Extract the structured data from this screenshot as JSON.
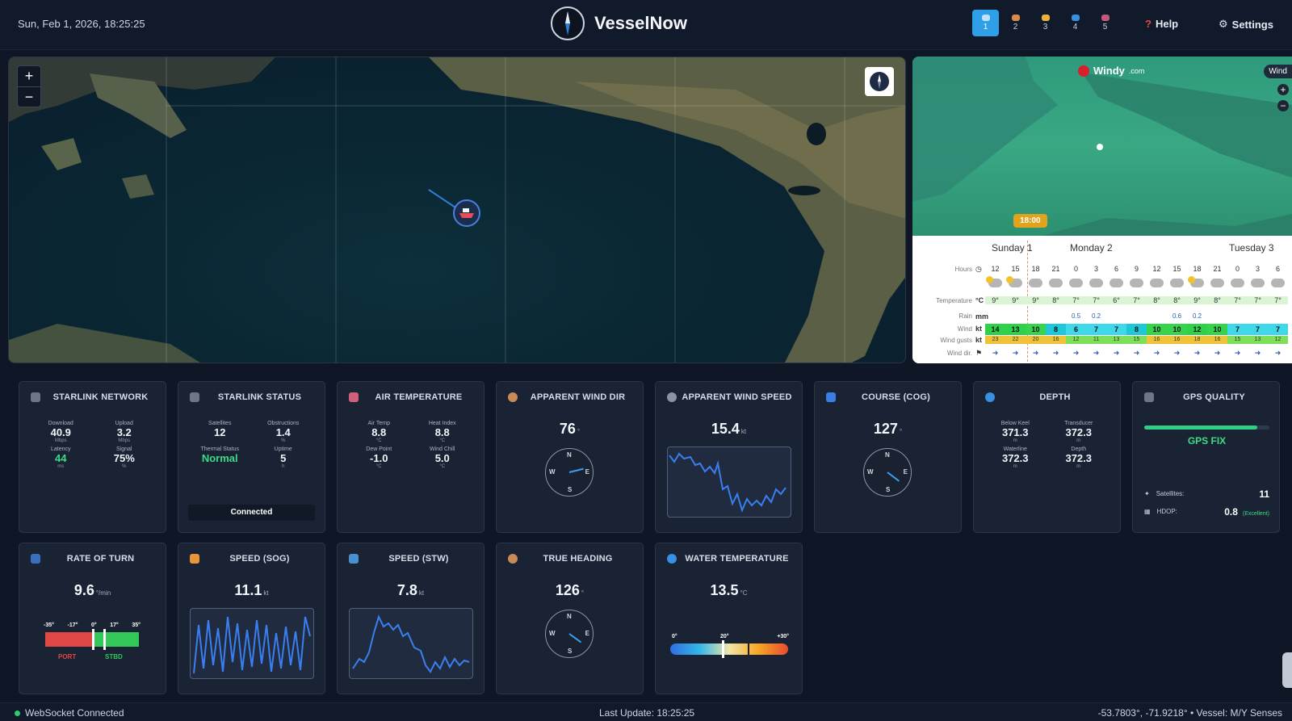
{
  "header": {
    "datetime": "Sun, Feb 1, 2026, 18:25:25",
    "brand": "VesselNow",
    "pages": [
      "1",
      "2",
      "3",
      "4",
      "5"
    ],
    "help": "Help",
    "settings": "Settings"
  },
  "windy": {
    "logo": "Windy",
    "logo_suffix": ".com",
    "layer": "Wind",
    "time_bubble": "18:00",
    "days": [
      "Sunday 1",
      "Monday 2",
      "Tuesday 3"
    ],
    "labels": {
      "hours": "Hours",
      "temperature": "Temperature",
      "rain": "Rain",
      "wind": "Wind",
      "gusts": "Wind gusts",
      "dir": "Wind dir."
    },
    "units": {
      "temp": "°C",
      "rain": "mm",
      "wind": "kt",
      "gusts": "kt"
    },
    "hours": [
      "12",
      "15",
      "18",
      "21",
      "0",
      "3",
      "6",
      "9",
      "12",
      "15",
      "18",
      "21",
      "0",
      "3",
      "6"
    ],
    "temps": [
      "9°",
      "9°",
      "9°",
      "8°",
      "7°",
      "7°",
      "6°",
      "7°",
      "8°",
      "8°",
      "9°",
      "8°",
      "7°",
      "7°",
      "7°"
    ],
    "rain": [
      "",
      "",
      "",
      "",
      "0.5",
      "0.2",
      "",
      "",
      "",
      "0.6",
      "0.2",
      "",
      "",
      "",
      ""
    ],
    "wind": [
      "14",
      "13",
      "10",
      "8",
      "6",
      "7",
      "7",
      "8",
      "10",
      "10",
      "12",
      "10",
      "7",
      "7",
      "7"
    ],
    "gusts": [
      "23",
      "22",
      "20",
      "16",
      "12",
      "11",
      "13",
      "15",
      "16",
      "16",
      "18",
      "16",
      "15",
      "13",
      "12"
    ]
  },
  "tiles": {
    "starlink_network": {
      "title": "STARLINK NETWORK",
      "download_label": "Download",
      "download": "40.9",
      "download_unit": "Mbps",
      "upload_label": "Upload",
      "upload": "3.2",
      "upload_unit": "Mbps",
      "latency_label": "Latency",
      "latency": "44",
      "latency_unit": "ms",
      "signal_label": "Signal",
      "signal": "75%",
      "signal_unit": "%"
    },
    "starlink_status": {
      "title": "STARLINK STATUS",
      "satellites_label": "Satellites",
      "satellites": "12",
      "obstructions_label": "Obstructions",
      "obstructions": "1.4",
      "obstructions_unit": "%",
      "thermal_label": "Thermal Status",
      "thermal": "Normal",
      "uptime_label": "Uptime",
      "uptime": "5",
      "uptime_unit": "h",
      "connection": "Connected"
    },
    "air_temp": {
      "title": "AIR TEMPERATURE",
      "air_label": "Air Temp",
      "air": "8.8",
      "air_unit": "°C",
      "heat_label": "Heat Index",
      "heat": "8.8",
      "heat_unit": "°C",
      "dew_label": "Dew Point",
      "dew": "-1.0",
      "dew_unit": "°C",
      "chill_label": "Wind Chill",
      "chill": "5.0",
      "chill_unit": "°C"
    },
    "app_wind_dir": {
      "title": "APPARENT WIND DIR",
      "value": "76",
      "unit": "°",
      "heading": 76
    },
    "app_wind_speed": {
      "title": "APPARENT WIND SPEED",
      "value": "15.4",
      "unit": "kt"
    },
    "cog": {
      "title": "COURSE (COG)",
      "value": "127",
      "unit": "°",
      "heading": 127
    },
    "depth": {
      "title": "DEPTH",
      "keel_label": "Below Keel",
      "keel": "371.3",
      "keel_unit": "m",
      "transducer_label": "Transducer",
      "transducer": "372.3",
      "transducer_unit": "m",
      "waterline_label": "Waterline",
      "waterline": "372.3",
      "waterline_unit": "m",
      "depth_label": "Depth",
      "depth": "372.3",
      "depth_unit": "m"
    },
    "gps": {
      "title": "GPS QUALITY",
      "fix": "GPS FIX",
      "sats_label": "Satellites:",
      "sats": "11",
      "hdop_label": "HDOP:",
      "hdop": "0.8",
      "hdop_quality": "(Excellent)",
      "signal_level": 0.9
    },
    "rot": {
      "title": "RATE OF TURN",
      "value": "9.6",
      "unit": "°/min",
      "ticks": [
        "-35°",
        "-17°",
        "0°",
        "17°",
        "35°"
      ],
      "port": "PORT",
      "stbd": "STBD"
    },
    "sog": {
      "title": "SPEED (SOG)",
      "value": "11.1",
      "unit": "kt"
    },
    "stw": {
      "title": "SPEED (STW)",
      "value": "7.8",
      "unit": "kt"
    },
    "true_heading": {
      "title": "TRUE HEADING",
      "value": "126",
      "unit": "°",
      "heading": 126
    },
    "water_temp": {
      "title": "WATER TEMPERATURE",
      "value": "13.5",
      "unit": "°C",
      "ticks": [
        "0°",
        "20°",
        "+30°"
      ]
    }
  },
  "compass_letters": {
    "n": "N",
    "s": "S",
    "e": "E",
    "w": "W"
  },
  "status": {
    "ws": "WebSocket Connected",
    "last_update": "Last Update:  18:25:25",
    "coords": "-53.7803°, -71.9218°  •  Vessel: M/Y Senses"
  }
}
